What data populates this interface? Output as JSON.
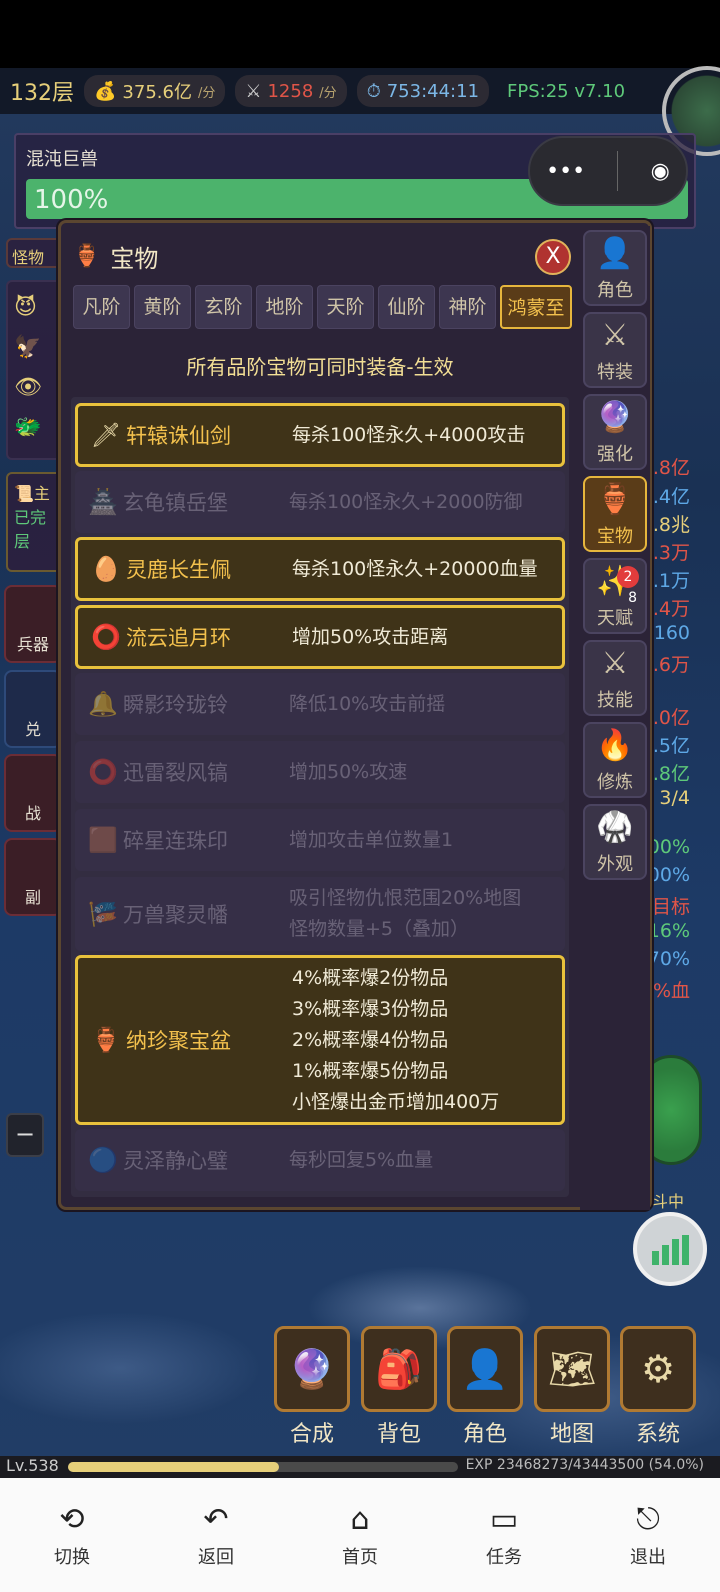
{
  "status": {
    "floor": "132层",
    "gold": "375.6亿",
    "gold_unit": "/分",
    "kills": "1258",
    "kills_unit": "/分",
    "timer": "753:44:11",
    "fps": "FPS:25 v7.10"
  },
  "boss": {
    "name": "混沌巨兽",
    "hp_text": "100%",
    "hp_percent": 100
  },
  "panel": {
    "title": "宝物",
    "close": "X",
    "subtitle": "所有品阶宝物可同时装备-生效",
    "tabs": [
      "凡阶",
      "黄阶",
      "玄阶",
      "地阶",
      "天阶",
      "仙阶",
      "神阶",
      "鸿蒙至"
    ],
    "items": [
      {
        "name": "轩辕诛仙剑",
        "desc": [
          "每杀100怪永久+4000攻击"
        ],
        "active": true,
        "icon": "sword-icon"
      },
      {
        "name": "玄龟镇岳堡",
        "desc": [
          "每杀100怪永久+2000防御"
        ],
        "active": false,
        "icon": "fortress-icon"
      },
      {
        "name": "灵鹿长生佩",
        "desc": [
          "每杀100怪永久+20000血量"
        ],
        "active": true,
        "icon": "jade-pendant-icon"
      },
      {
        "name": "流云追月环",
        "desc": [
          "增加50%攻击距离"
        ],
        "active": true,
        "icon": "ring-icon"
      },
      {
        "name": "瞬影玲珑铃",
        "desc": [
          "降低10%攻击前摇"
        ],
        "active": false,
        "icon": "bell-icon"
      },
      {
        "name": "迅雷裂风镐",
        "desc": [
          "增加50%攻速"
        ],
        "active": false,
        "icon": "bracelet-icon"
      },
      {
        "name": "碎星连珠印",
        "desc": [
          "增加攻击单位数量1"
        ],
        "active": false,
        "icon": "seal-icon"
      },
      {
        "name": "万兽聚灵幡",
        "desc": [
          "吸引怪物仇恨范围20%地图",
          "怪物数量+5（叠加）"
        ],
        "active": false,
        "icon": "banner-icon"
      },
      {
        "name": "纳珍聚宝盆",
        "desc": [
          "4%概率爆2份物品",
          "3%概率爆3份物品",
          "2%概率爆4份物品",
          "1%概率爆5份物品",
          "小怪爆出金币增加400万"
        ],
        "active": true,
        "icon": "treasure-bowl-icon"
      },
      {
        "name": "灵泽静心璧",
        "desc": [
          "每秒回复5%血量"
        ],
        "active": false,
        "icon": "orb-icon"
      }
    ]
  },
  "side_nav": [
    {
      "label": "角色",
      "icon": "person-icon"
    },
    {
      "label": "特装",
      "icon": "crossed-swords-icon"
    },
    {
      "label": "强化",
      "icon": "crystal-ball-icon"
    },
    {
      "label": "宝物",
      "icon": "jar-icon",
      "active": true
    },
    {
      "label": "天赋",
      "icon": "sparkle-icon",
      "badge": "2",
      "count": "8"
    },
    {
      "label": "技能",
      "icon": "crossed-swords-icon"
    },
    {
      "label": "修炼",
      "icon": "fire-icon"
    },
    {
      "label": "外观",
      "icon": "robe-icon"
    }
  ],
  "right_stats": [
    ".8亿",
    ".4亿",
    ".8兆",
    ".3万",
    ".1万",
    ".4万",
    "160",
    ".6万",
    ".0亿",
    ".5亿",
    ".8亿",
    "3/4",
    "00%",
    "00%",
    "目标",
    "16%",
    "70%",
    "%血"
  ],
  "left": {
    "monster_label": "怪物",
    "quest_text": "主",
    "quest_done": "已完",
    "quest_floor": "层",
    "buttons": [
      "兵器",
      "兑",
      "战",
      "副"
    ],
    "minus": "−"
  },
  "bottom_buttons": [
    {
      "label": "合成",
      "icon": "crystal-ball-icon"
    },
    {
      "label": "背包",
      "icon": "backpack-icon"
    },
    {
      "label": "角色",
      "icon": "person-icon"
    },
    {
      "label": "地图",
      "icon": "map-icon"
    },
    {
      "label": "系统",
      "icon": "gear-icon"
    }
  ],
  "fight_text": "斗中",
  "level": {
    "lv": "Lv.538",
    "exp_text": "EXP 23468273/43443500 (54.0%)",
    "exp_fraction": 0.54
  },
  "nav": [
    {
      "label": "切换",
      "icon": "switch-icon"
    },
    {
      "label": "返回",
      "icon": "back-icon"
    },
    {
      "label": "首页",
      "icon": "home-icon"
    },
    {
      "label": "任务",
      "icon": "task-icon"
    },
    {
      "label": "退出",
      "icon": "exit-icon"
    }
  ],
  "colors": {
    "accent": "#e9c23c",
    "hp_green": "#4cb36c",
    "panel_bg": "#2b2337"
  }
}
